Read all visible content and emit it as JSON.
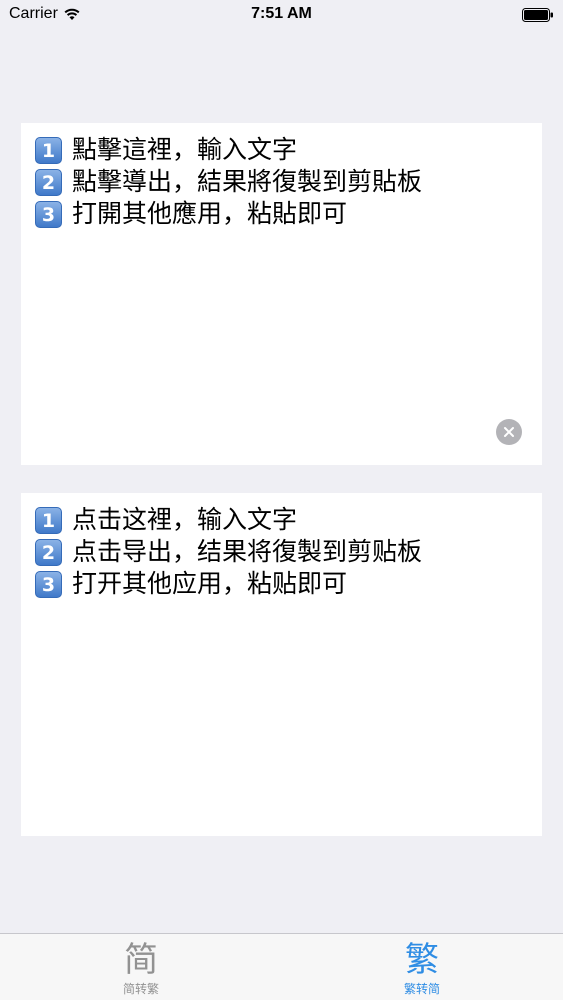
{
  "status_bar": {
    "carrier": "Carrier",
    "time": "7:51 AM"
  },
  "input_box": {
    "lines": [
      {
        "badge": "1",
        "text": "點擊這裡，輸入文字"
      },
      {
        "badge": "2",
        "text": "點擊導出，結果將復製到剪貼板"
      },
      {
        "badge": "3",
        "text": "打開其他應用，粘貼即可"
      }
    ],
    "clear_icon": "clear-circle-icon"
  },
  "output_box": {
    "lines": [
      {
        "badge": "1",
        "text": "点击这裡，输入文字"
      },
      {
        "badge": "2",
        "text": "点击导出，结果将復製到剪贴板"
      },
      {
        "badge": "3",
        "text": "打开其他应用，粘贴即可"
      }
    ]
  },
  "tab_bar": {
    "tabs": [
      {
        "icon": "简",
        "label": "简转繁",
        "selected": false
      },
      {
        "icon": "繁",
        "label": "繁转简",
        "selected": true
      }
    ]
  },
  "colors": {
    "background": "#efeff4",
    "accent": "#2f8de4",
    "inactive": "#929292"
  }
}
